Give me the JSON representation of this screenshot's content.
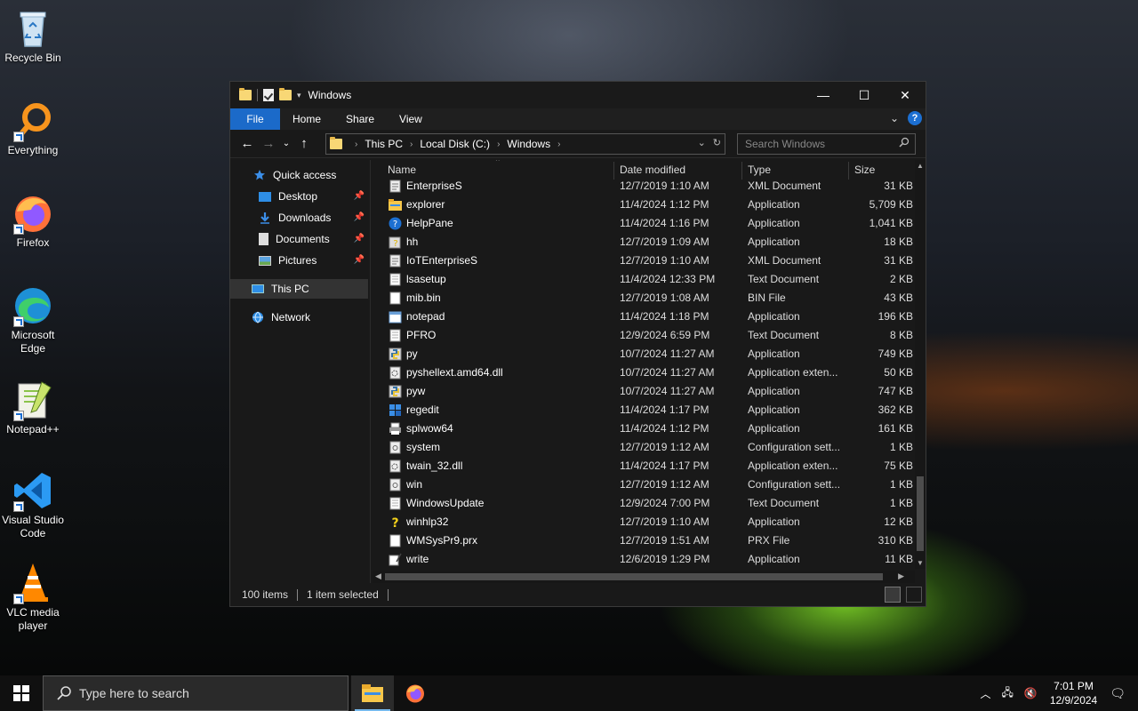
{
  "desktop": {
    "icons": [
      {
        "label": "Recycle Bin"
      },
      {
        "label": "Everything"
      },
      {
        "label": "Firefox"
      },
      {
        "label": "Microsoft Edge"
      },
      {
        "label": "Notepad++"
      },
      {
        "label": "Visual Studio Code"
      },
      {
        "label": "VLC media player"
      }
    ]
  },
  "window": {
    "title": "Windows",
    "controls": {
      "minimize": "—",
      "maximize": "☐",
      "close": "✕"
    },
    "ribbon_tabs": [
      "File",
      "Home",
      "Share",
      "View"
    ],
    "address": {
      "crumbs": [
        "This PC",
        "Local Disk (C:)",
        "Windows"
      ]
    },
    "search": {
      "placeholder": "Search Windows"
    },
    "nav_pane": {
      "items": [
        {
          "label": "Quick access"
        },
        {
          "label": "Desktop"
        },
        {
          "label": "Downloads"
        },
        {
          "label": "Documents"
        },
        {
          "label": "Pictures"
        },
        {
          "label": "This PC"
        },
        {
          "label": "Network"
        }
      ]
    },
    "columns": {
      "name": "Name",
      "date": "Date modified",
      "type": "Type",
      "size": "Size"
    },
    "files": [
      {
        "name": "EnterpriseS",
        "date": "12/7/2019 1:10 AM",
        "type": "XML Document",
        "size": "31 KB",
        "icon": "xml-file-icon"
      },
      {
        "name": "explorer",
        "date": "11/4/2024 1:12 PM",
        "type": "Application",
        "size": "5,709 KB",
        "icon": "explorer-app-icon"
      },
      {
        "name": "HelpPane",
        "date": "11/4/2024 1:16 PM",
        "type": "Application",
        "size": "1,041 KB",
        "icon": "help-app-icon"
      },
      {
        "name": "hh",
        "date": "12/7/2019 1:09 AM",
        "type": "Application",
        "size": "18 KB",
        "icon": "hh-app-icon"
      },
      {
        "name": "IoTEnterpriseS",
        "date": "12/7/2019 1:10 AM",
        "type": "XML Document",
        "size": "31 KB",
        "icon": "xml-file-icon"
      },
      {
        "name": "lsasetup",
        "date": "11/4/2024 12:33 PM",
        "type": "Text Document",
        "size": "2 KB",
        "icon": "text-file-icon"
      },
      {
        "name": "mib.bin",
        "date": "12/7/2019 1:08 AM",
        "type": "BIN File",
        "size": "43 KB",
        "icon": "blank-file-icon"
      },
      {
        "name": "notepad",
        "date": "11/4/2024 1:18 PM",
        "type": "Application",
        "size": "196 KB",
        "icon": "notepad-app-icon"
      },
      {
        "name": "PFRO",
        "date": "12/9/2024 6:59 PM",
        "type": "Text Document",
        "size": "8 KB",
        "icon": "text-file-icon"
      },
      {
        "name": "py",
        "date": "10/7/2024 11:27 AM",
        "type": "Application",
        "size": "749 KB",
        "icon": "python-app-icon"
      },
      {
        "name": "pyshellext.amd64.dll",
        "date": "10/7/2024 11:27 AM",
        "type": "Application exten...",
        "size": "50 KB",
        "icon": "dll-file-icon"
      },
      {
        "name": "pyw",
        "date": "10/7/2024 11:27 AM",
        "type": "Application",
        "size": "747 KB",
        "icon": "python-app-icon"
      },
      {
        "name": "regedit",
        "date": "11/4/2024 1:17 PM",
        "type": "Application",
        "size": "362 KB",
        "icon": "regedit-app-icon"
      },
      {
        "name": "splwow64",
        "date": "11/4/2024 1:12 PM",
        "type": "Application",
        "size": "161 KB",
        "icon": "printer-app-icon"
      },
      {
        "name": "system",
        "date": "12/7/2019 1:12 AM",
        "type": "Configuration sett...",
        "size": "1 KB",
        "icon": "config-file-icon"
      },
      {
        "name": "twain_32.dll",
        "date": "11/4/2024 1:17 PM",
        "type": "Application exten...",
        "size": "75 KB",
        "icon": "dll-file-icon"
      },
      {
        "name": "win",
        "date": "12/7/2019 1:12 AM",
        "type": "Configuration sett...",
        "size": "1 KB",
        "icon": "config-file-icon"
      },
      {
        "name": "WindowsUpdate",
        "date": "12/9/2024 7:00 PM",
        "type": "Text Document",
        "size": "1 KB",
        "icon": "text-file-icon"
      },
      {
        "name": "winhlp32",
        "date": "12/7/2019 1:10 AM",
        "type": "Application",
        "size": "12 KB",
        "icon": "winhlp-app-icon"
      },
      {
        "name": "WMSysPr9.prx",
        "date": "12/7/2019 1:51 AM",
        "type": "PRX File",
        "size": "310 KB",
        "icon": "blank-file-icon"
      },
      {
        "name": "write",
        "date": "12/6/2019 1:29 PM",
        "type": "Application",
        "size": "11 KB",
        "icon": "write-app-icon"
      }
    ],
    "status": {
      "count": "100 items",
      "selection": "1 item selected"
    }
  },
  "taskbar": {
    "search_placeholder": "Type here to search",
    "clock_time": "7:01 PM",
    "clock_date": "12/9/2024"
  },
  "colors": {
    "accent": "#1b6ac9",
    "window_bg": "#191919",
    "selected_bg": "#333333"
  }
}
